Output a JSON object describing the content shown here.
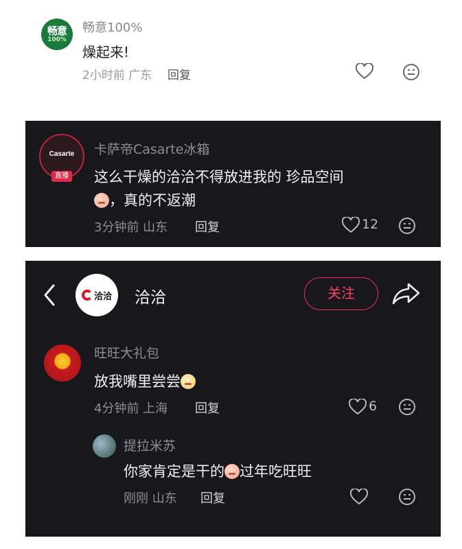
{
  "comment1": {
    "avatar_line1": "畅意",
    "avatar_line2": "100%",
    "username": "畅意100%",
    "text": "燥起来!",
    "meta": "2小时前 广东",
    "reply": "回复"
  },
  "comment2": {
    "avatar_brand": "Casarte",
    "live_badge": "直播",
    "username": "卡萨帝Casarte冰箱",
    "text_line1": "这么干燥的洽洽不得放进我的 珍品空间",
    "text_line2": "，真的不返潮",
    "meta": "3分钟前 山东",
    "reply": "回复",
    "like_count": "12"
  },
  "header": {
    "logo_text": "洽洽",
    "name": "洽洽",
    "follow_label": "关注"
  },
  "comment3": {
    "username": "旺旺大礼包",
    "text": "放我嘴里尝尝",
    "meta": "4分钟前 上海",
    "reply": "回复",
    "like_count": "6"
  },
  "comment4": {
    "username": "提拉米苏",
    "text_before": "你家肯定是干的",
    "text_after": "过年吃旺旺",
    "meta": "刚刚 山东",
    "reply": "回复"
  },
  "icons": {
    "heart": "heart-icon",
    "emoji": "emoji-face-icon",
    "back": "back-arrow-icon",
    "share": "share-icon"
  },
  "colors": {
    "dark_panel": "#17171c",
    "follow_accent": "#ff3f64",
    "brand_green": "#1a7a3b"
  }
}
